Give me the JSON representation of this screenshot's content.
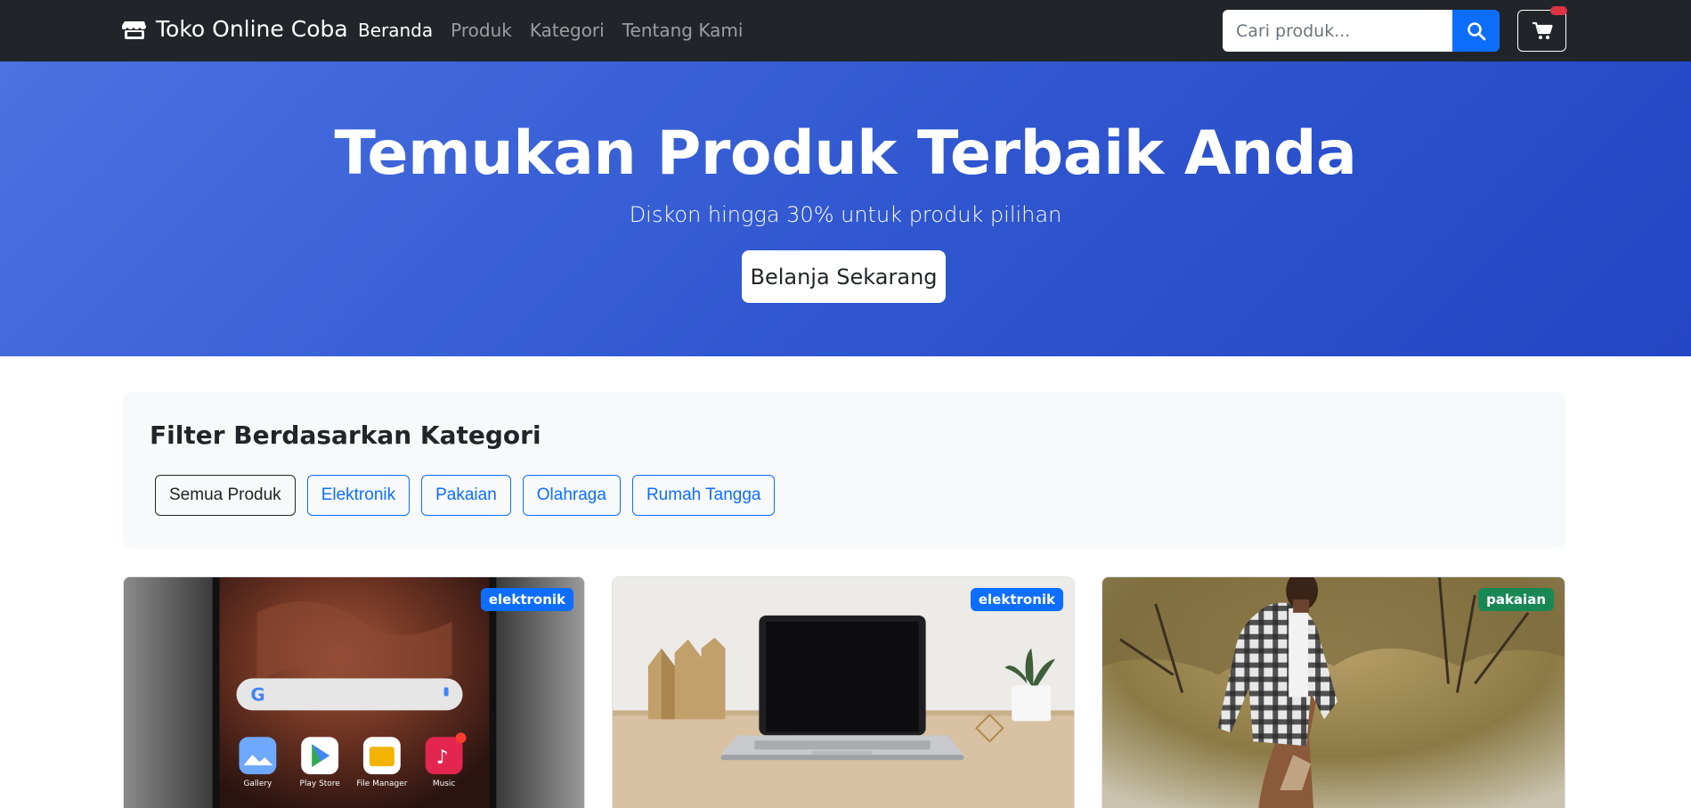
{
  "navbar": {
    "brand": "Toko Online Coba",
    "brand_icon": "store-icon",
    "links": [
      {
        "label": "Beranda",
        "active": true
      },
      {
        "label": "Produk",
        "active": false
      },
      {
        "label": "Kategori",
        "active": false
      },
      {
        "label": "Tentang Kami",
        "active": false
      }
    ],
    "search_placeholder": "Cari produk...",
    "search_icon": "search-icon",
    "cart_icon": "cart-icon"
  },
  "hero": {
    "title": "Temukan Produk Terbaik Anda",
    "subtitle": "Diskon hingga 30% untuk produk pilihan",
    "button_label": "Belanja Sekarang"
  },
  "filter": {
    "title": "Filter Berdasarkan Kategori",
    "categories": [
      "Semua Produk",
      "Elektronik",
      "Pakaian",
      "Olahraga",
      "Rumah Tangga"
    ],
    "active_index": 0
  },
  "products": [
    {
      "category": "elektronik",
      "badge_color": "#0d6efd",
      "image": "smartphone-photo"
    },
    {
      "category": "elektronik",
      "badge_color": "#0d6efd",
      "image": "laptop-photo"
    },
    {
      "category": "pakaian",
      "badge_color": "#198754",
      "image": "flannel-shirt-photo"
    }
  ],
  "phone_app_labels": [
    "Gallery",
    "Play Store",
    "File Manager",
    "Music"
  ],
  "colors": {
    "navbar": "#212529",
    "primary": "#0d6efd",
    "success": "#198754",
    "danger": "#dc3545"
  }
}
